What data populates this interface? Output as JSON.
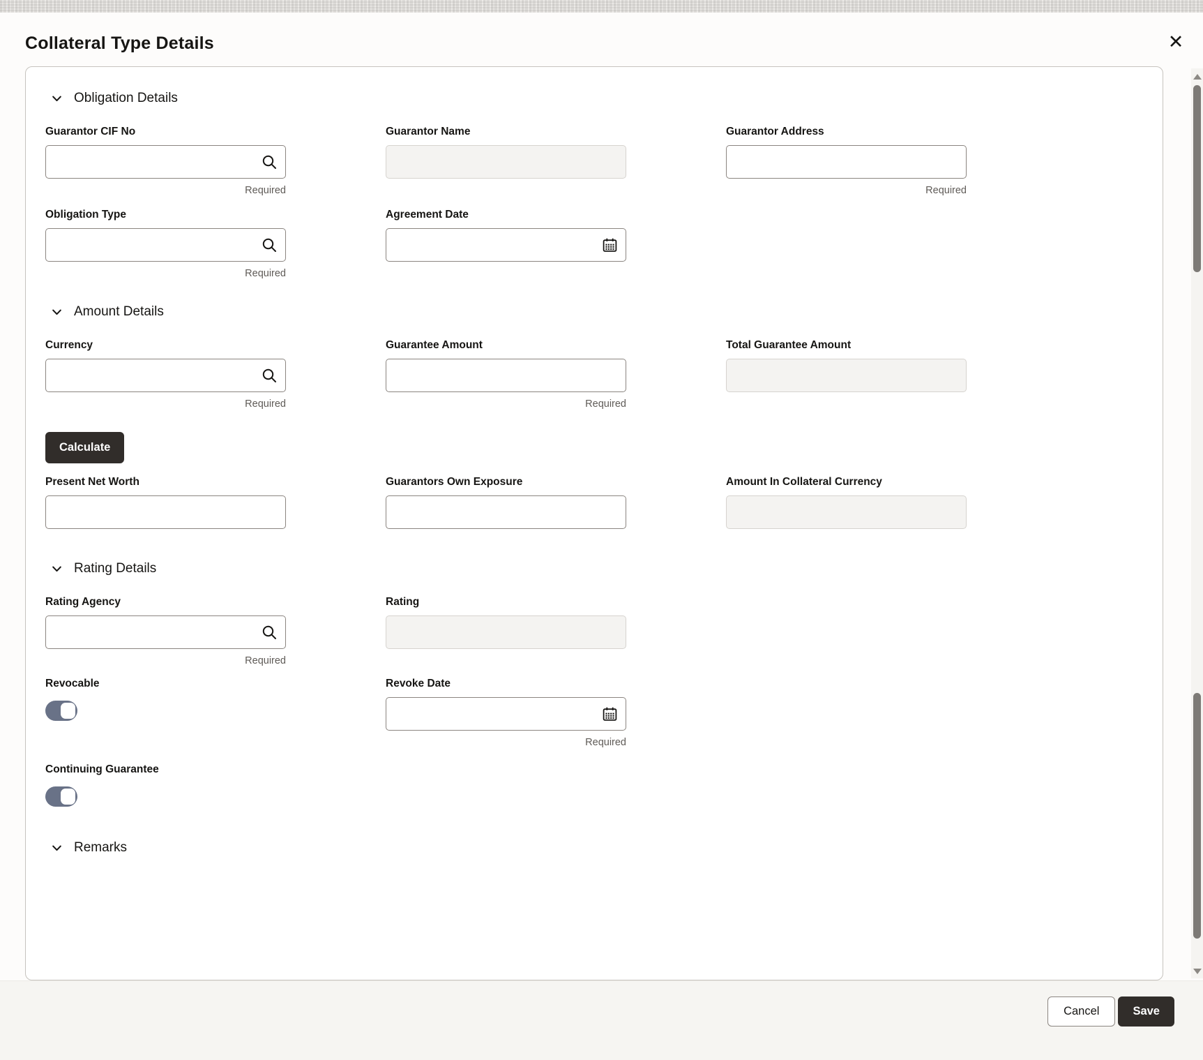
{
  "dialog": {
    "title": "Collateral Type Details"
  },
  "icons": {
    "close": "✕"
  },
  "hints": {
    "required": "Required"
  },
  "sections": {
    "obligation": "Obligation Details",
    "amount": "Amount Details",
    "rating": "Rating Details",
    "remarks": "Remarks"
  },
  "fields": {
    "guarantor_cif_no": {
      "label": "Guarantor CIF No",
      "value": "",
      "required": true
    },
    "guarantor_name": {
      "label": "Guarantor Name",
      "value": "",
      "disabled": true
    },
    "guarantor_address": {
      "label": "Guarantor Address",
      "value": "",
      "required": true
    },
    "obligation_type": {
      "label": "Obligation Type",
      "value": "",
      "required": true
    },
    "agreement_date": {
      "label": "Agreement Date",
      "value": ""
    },
    "currency": {
      "label": "Currency",
      "value": "",
      "required": true
    },
    "guarantee_amount": {
      "label": "Guarantee Amount",
      "value": "",
      "required": true
    },
    "total_guarantee_amount": {
      "label": "Total Guarantee Amount",
      "value": "",
      "disabled": true
    },
    "present_net_worth": {
      "label": "Present Net Worth",
      "value": ""
    },
    "guarantors_own_exposure": {
      "label": "Guarantors Own Exposure",
      "value": ""
    },
    "amount_in_collateral_currency": {
      "label": "Amount In Collateral Currency",
      "value": "",
      "disabled": true
    },
    "rating_agency": {
      "label": "Rating Agency",
      "value": "",
      "required": true
    },
    "rating": {
      "label": "Rating",
      "value": "",
      "disabled": true
    },
    "revocable": {
      "label": "Revocable",
      "value": true
    },
    "revoke_date": {
      "label": "Revoke Date",
      "value": "",
      "required": true
    },
    "continuing_guarantee": {
      "label": "Continuing Guarantee",
      "value": true
    }
  },
  "buttons": {
    "calculate": "Calculate",
    "cancel": "Cancel",
    "save": "Save"
  },
  "colors": {
    "accent_dark": "#312d2a",
    "toggle_on": "#697287",
    "panel_border": "#c6c3be",
    "required_text": "#5f5b57"
  }
}
